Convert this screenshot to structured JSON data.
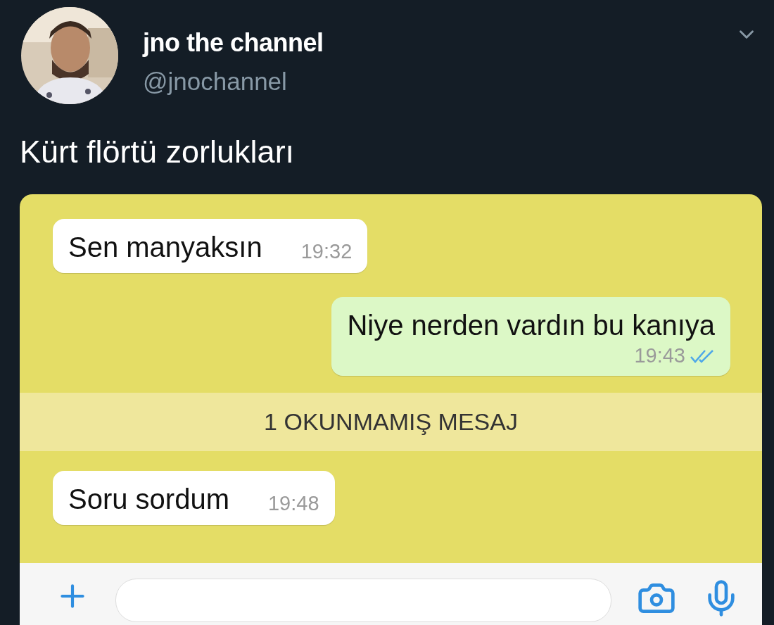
{
  "tweet": {
    "author": {
      "name": "jno the channel",
      "handle": "@jnochannel"
    },
    "text": "Kürt flörtü zorlukları"
  },
  "chat": {
    "messages": [
      {
        "kind": "incoming",
        "text": "Sen manyaksın",
        "time": "19:32"
      },
      {
        "kind": "outgoing",
        "text": "Niye nerden vardın bu kanıya",
        "time": "19:43",
        "read": true
      },
      {
        "kind": "unread_banner",
        "text": "1 OKUNMAMIŞ MESAJ"
      },
      {
        "kind": "incoming",
        "text": "Soru sordum",
        "time": "19:48"
      }
    ]
  }
}
